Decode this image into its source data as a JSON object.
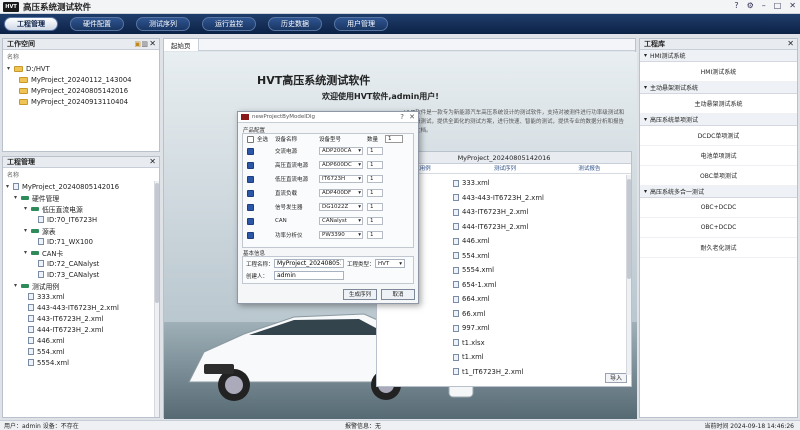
{
  "app": {
    "logo": "HVT",
    "title": "高压系统测试软件",
    "window_icons": [
      "?",
      "⚙",
      "–",
      "□",
      "✕"
    ]
  },
  "menu": [
    {
      "label": "工程管理",
      "active": true
    },
    {
      "label": "硬件配置"
    },
    {
      "label": "测试序列"
    },
    {
      "label": "运行监控"
    },
    {
      "label": "历史数据"
    },
    {
      "label": "用户管理"
    }
  ],
  "workspace": {
    "title": "工作空间",
    "name_header": "名称",
    "root": "D:/HVT",
    "items": [
      "MyProject_20240112_143004",
      "MyProject_20240805142016",
      "MyProject_20240913110404"
    ]
  },
  "project_mgmt": {
    "title": "工程管理",
    "name_header": "名称",
    "root": "MyProject_20240805142016",
    "hardware": "硬件管理",
    "power": "低压直流电源",
    "power_id": "ID:70_IT6723H",
    "dmm": "源表",
    "dmm_id": "ID:71_WX100",
    "can": "CAN卡",
    "can_ids": [
      "ID:72_CANalyst",
      "ID:73_CANalyst"
    ],
    "tests": "测试用例",
    "test_files": [
      "333.xml",
      "443-443-IT6723H_2.xml",
      "443-IT6723H_2.xml",
      "444-IT6723H_2.xml",
      "446.xml",
      "554.xml",
      "5554.xml"
    ]
  },
  "tab": {
    "label": "起始页"
  },
  "welcome": {
    "title": "HVT高压系统测试软件",
    "greeting": "欢迎使用HVT软件,admin用户!",
    "blurb": "HVT软件是一款专为新能源汽车高压系统设计的测试软件，支持对被测件进行功率级测试和信号级测试，提供全面化的测试方案，进行快速、智能的测试，提供专业的数据分析和报告生成文档。"
  },
  "project_list": {
    "title": "MyProject_20240805142016",
    "col1": "测试用例",
    "col2": "测试序列",
    "col3": "测试报告",
    "files": [
      "333.xml",
      "443-443-IT6723H_2.xml",
      "443-IT6723H_2.xml",
      "444-IT6723H_2.xml",
      "446.xml",
      "554.xml",
      "5554.xml",
      "654-1.xml",
      "664.xml",
      "66.xml",
      "997.xml",
      "t1.xlsx",
      "t1.xml",
      "t1_IT6723H_2.xml"
    ],
    "import_btn": "导入"
  },
  "dialog": {
    "title": "newProjectByModelDlg",
    "help": "?",
    "close": "✕",
    "group1": "产品配置",
    "select_all": "全选",
    "col_name": "设备名称",
    "col_model": "设备型号",
    "col_count": "数量",
    "total_count": "1",
    "devices": [
      {
        "name": "交流电源",
        "model": "ADP200CA",
        "count": "1"
      },
      {
        "name": "高压直流电源",
        "model": "ADP600DC",
        "count": "1"
      },
      {
        "name": "低压直流电源",
        "model": "IT6723H",
        "count": "1"
      },
      {
        "name": "直流负载",
        "model": "ADP400DF",
        "count": "1"
      },
      {
        "name": "信号发生器",
        "model": "DG1022Z",
        "count": "1"
      },
      {
        "name": "CAN",
        "model": "CANalyst",
        "count": "1"
      },
      {
        "name": "功率分析仪",
        "model": "PW3390",
        "count": "1"
      }
    ],
    "group2": "基本信息",
    "project_name_label": "工程名称：",
    "project_name": "MyProject_20240805142016",
    "type_label": "工程类型：",
    "type_value": "HVT",
    "creator_label": "创建人：",
    "creator": "admin",
    "ok": "生成序列",
    "cancel": "取消"
  },
  "library": {
    "title": "工程库",
    "groups": [
      {
        "name": "HMI测试系统",
        "items": [
          "HMI测试系统"
        ]
      },
      {
        "name": "主动悬架测试系统",
        "items": [
          "主动悬架测试系统"
        ]
      },
      {
        "name": "高压系统单项测试",
        "items": [
          "DCDC单项测试",
          "电池单项测试",
          "OBC单项测试"
        ]
      },
      {
        "name": "高压系统多合一测试",
        "items": [
          "OBC+DCDC",
          "OBC+DCDC",
          "耐久老化测试"
        ]
      }
    ]
  },
  "status": {
    "left": "用户：admin  设备：不存在",
    "middle": "报警信息：无",
    "right": "当前时间  2024-09-18 14:46:26"
  }
}
